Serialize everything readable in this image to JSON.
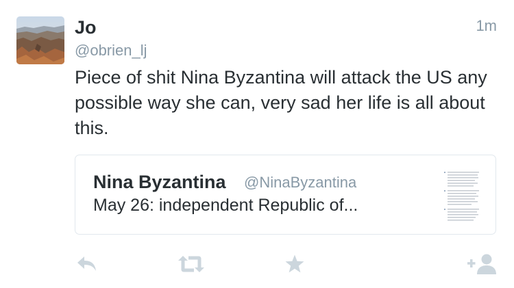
{
  "tweet": {
    "author_name": "Jo",
    "author_handle": "@obrien_lj",
    "timestamp": "1m",
    "text": "Piece of shit Nina Byzantina will attack the US any possible way she can, very sad her life is all about this.",
    "avatar_icon": "canyon-landscape-photo"
  },
  "quoted_tweet": {
    "author_name": "Nina Byzantina",
    "author_handle": "@NinaByzantina",
    "text": "May 26: independent Republic of...",
    "thumbnail_icon": "document-text-thumbnail"
  },
  "actions": {
    "reply_icon": "reply-icon",
    "retweet_icon": "retweet-icon",
    "favorite_icon": "star-icon",
    "follow_icon": "follow-user-icon"
  },
  "colors": {
    "text": "#292f33",
    "secondary": "#8899a6",
    "icon": "#ccd6dd",
    "border": "#e1e8ed"
  }
}
